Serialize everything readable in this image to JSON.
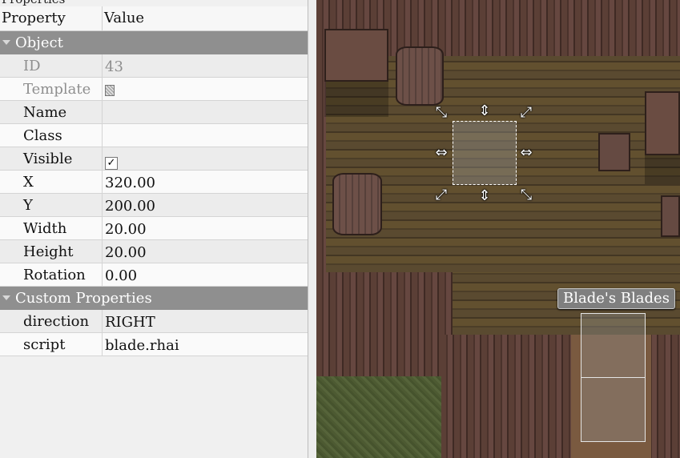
{
  "panel": {
    "title": "Properties",
    "title_buttons": "□ ×",
    "header": {
      "property": "Property",
      "value": "Value"
    }
  },
  "groups": {
    "object": "Object",
    "custom": "Custom Properties"
  },
  "object_props": [
    {
      "key": "ID",
      "value": "43",
      "disabled": true
    },
    {
      "key": "Template",
      "value": "",
      "disabled": true,
      "icon": "template-icon"
    },
    {
      "key": "Name",
      "value": ""
    },
    {
      "key": "Class",
      "value": ""
    },
    {
      "key": "Visible",
      "value": "✓",
      "checkbox": true
    },
    {
      "key": "X",
      "value": "320.00"
    },
    {
      "key": "Y",
      "value": "200.00"
    },
    {
      "key": "Width",
      "value": "20.00"
    },
    {
      "key": "Height",
      "value": "20.00"
    },
    {
      "key": "Rotation",
      "value": "0.00"
    }
  ],
  "custom_props": [
    {
      "key": "direction",
      "value": "RIGHT"
    },
    {
      "key": "script",
      "value": "blade.rhai"
    }
  ],
  "map": {
    "npc_label": "Blade's Blades",
    "handles": {
      "nw": "⤡",
      "n": "⇕",
      "ne": "⤢",
      "w": "⇔",
      "e": "⇔",
      "sw": "⤢",
      "s": "⇕",
      "se": "⤡"
    }
  },
  "colors": {
    "panel_bg": "#f0f0f0",
    "group_header": "#8f8f8f",
    "selection_border": "#ffffff"
  }
}
